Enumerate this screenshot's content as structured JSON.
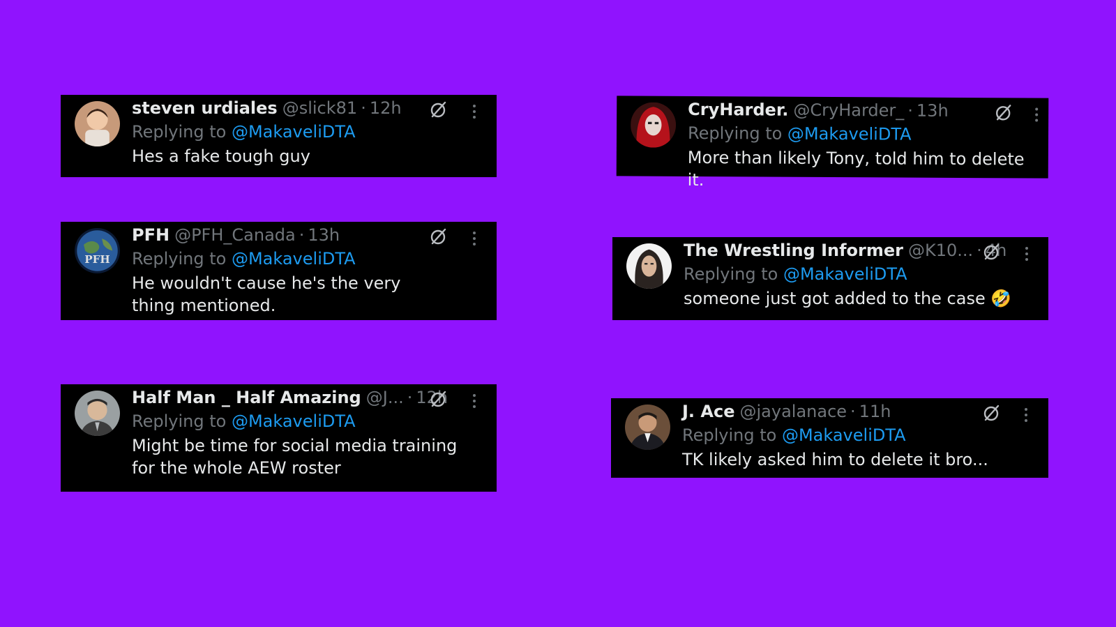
{
  "tweets": [
    {
      "name": "steven urdiales",
      "handle": "@slick81",
      "time": "12h",
      "reply_prefix": "Replying to",
      "mention": "@MakaveliDTA",
      "text": "Hes a fake tough guy"
    },
    {
      "name": "PFH",
      "handle": "@PFH_Canada",
      "time": "13h",
      "reply_prefix": "Replying to",
      "mention": "@MakaveliDTA",
      "text": "He wouldn't cause he's the very thing mentioned.",
      "avatar_text": "PFH"
    },
    {
      "name": "Half Man _ Half Amazing",
      "handle": "@J...",
      "time": "12h",
      "reply_prefix": "Replying to",
      "mention": "@MakaveliDTA",
      "text": "Might be time for social media training for the whole AEW roster"
    },
    {
      "name": "CryHarder.",
      "handle": "@CryHarder_",
      "time": "13h",
      "reply_prefix": "Replying to",
      "mention": "@MakaveliDTA",
      "text": "More than likely Tony, told him to delete it."
    },
    {
      "name": "The Wrestling Informer",
      "handle": "@K10...",
      "time": "4h",
      "reply_prefix": "Replying to",
      "mention": "@MakaveliDTA",
      "text": "someone just got added to the case 🤣"
    },
    {
      "name": "J. Ace",
      "handle": "@jayalanace",
      "time": "11h",
      "reply_prefix": "Replying to",
      "mention": "@MakaveliDTA",
      "text": "TK likely asked him to delete it bro..."
    }
  ],
  "separator": "·",
  "icons": {
    "grok": "grok-slash-circle-icon",
    "more": "more-vertical-icon"
  },
  "colors": {
    "background": "#9013fe",
    "card": "#000000",
    "text": "#e7e9ea",
    "secondary": "#71767b",
    "mention": "#1d9bf0"
  }
}
